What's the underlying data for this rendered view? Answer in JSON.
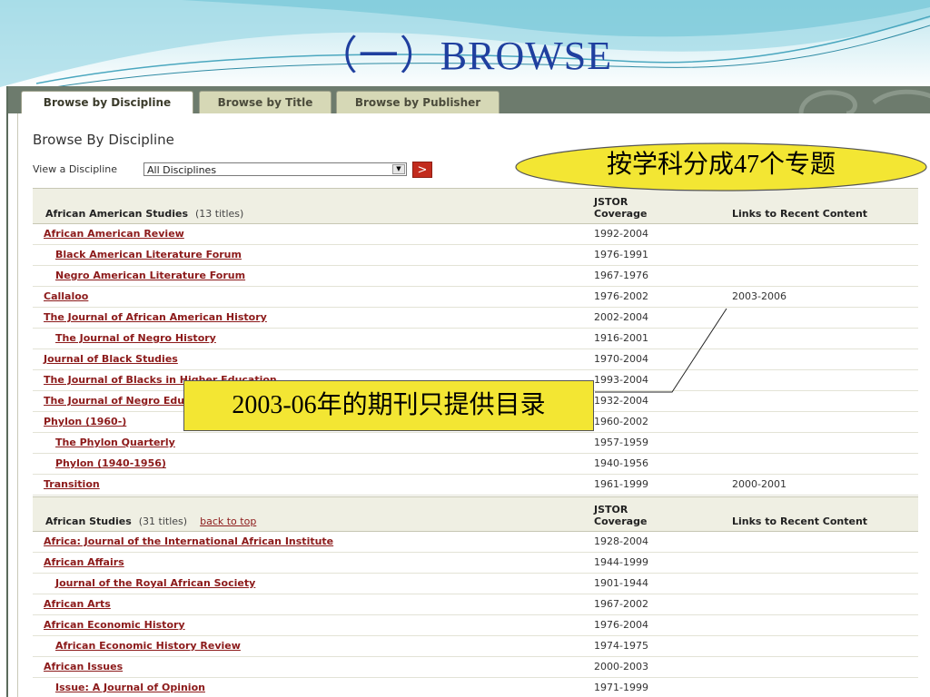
{
  "slide": {
    "title": "（一）BROWSE"
  },
  "tabs": [
    {
      "label": "Browse by Discipline",
      "active": true
    },
    {
      "label": "Browse by Title",
      "active": false
    },
    {
      "label": "Browse by Publisher",
      "active": false
    }
  ],
  "panel": {
    "heading": "Browse By Discipline",
    "view_label": "View a Discipline",
    "select_value": "All Disciplines",
    "go_label": ">"
  },
  "columns": {
    "coverage_line1": "JSTOR",
    "coverage_line2": "Coverage",
    "links": "Links to Recent Content"
  },
  "sections": [
    {
      "name": "African American Studies",
      "count": "(13 titles)",
      "back_to_top": "",
      "rows": [
        {
          "title": "African American Review",
          "coverage": "1992-2004",
          "links": "",
          "indent": false
        },
        {
          "title": "Black American Literature Forum",
          "coverage": "1976-1991",
          "links": "",
          "indent": true
        },
        {
          "title": "Negro American Literature Forum",
          "coverage": "1967-1976",
          "links": "",
          "indent": true
        },
        {
          "title": "Callaloo",
          "coverage": "1976-2002",
          "links": "2003-2006",
          "indent": false
        },
        {
          "title": "The Journal of African American History",
          "coverage": "2002-2004",
          "links": "",
          "indent": false
        },
        {
          "title": "The Journal of Negro History",
          "coverage": "1916-2001",
          "links": "",
          "indent": true
        },
        {
          "title": "Journal of Black Studies",
          "coverage": "1970-2004",
          "links": "",
          "indent": false
        },
        {
          "title": "The Journal of Blacks in Higher Education",
          "coverage": "1993-2004",
          "links": "",
          "indent": false
        },
        {
          "title": "The Journal of Negro Education",
          "coverage": "1932-2004",
          "links": "",
          "indent": false
        },
        {
          "title": "Phylon (1960-)",
          "coverage": "1960-2002",
          "links": "",
          "indent": false
        },
        {
          "title": "The Phylon Quarterly",
          "coverage": "1957-1959",
          "links": "",
          "indent": true
        },
        {
          "title": "Phylon (1940-1956)",
          "coverage": "1940-1956",
          "links": "",
          "indent": true
        },
        {
          "title": "Transition",
          "coverage": "1961-1999",
          "links": "2000-2001",
          "indent": false
        }
      ]
    },
    {
      "name": "African Studies",
      "count": "(31 titles)",
      "back_to_top": "back to top",
      "rows": [
        {
          "title": "Africa: Journal of the International African Institute",
          "coverage": "1928-2004",
          "links": "",
          "indent": false
        },
        {
          "title": "African Affairs",
          "coverage": "1944-1999",
          "links": "",
          "indent": false
        },
        {
          "title": "Journal of the Royal African Society",
          "coverage": "1901-1944",
          "links": "",
          "indent": true
        },
        {
          "title": "African Arts",
          "coverage": "1967-2002",
          "links": "",
          "indent": false
        },
        {
          "title": "African Economic History",
          "coverage": "1976-2004",
          "links": "",
          "indent": false
        },
        {
          "title": "African Economic History Review",
          "coverage": "1974-1975",
          "links": "",
          "indent": true
        },
        {
          "title": "African Issues",
          "coverage": "2000-2003",
          "links": "",
          "indent": false
        },
        {
          "title": "Issue: A Journal of Opinion",
          "coverage": "1971-1999",
          "links": "",
          "indent": true
        }
      ]
    }
  ],
  "callouts": {
    "disciplines": "按学科分成47个专题",
    "recent": "2003-06年的期刊只提供目录"
  },
  "colors": {
    "link": "#8c1a1a",
    "title": "#1f3f9f",
    "tabbar": "#6d7b6d",
    "callout": "#f3e633"
  }
}
